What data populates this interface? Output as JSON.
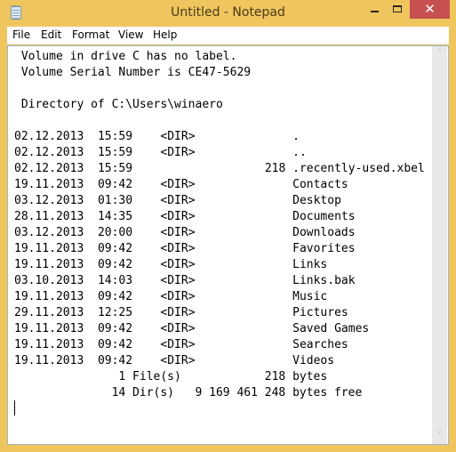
{
  "window": {
    "title": "Untitled - Notepad",
    "app_icon": "notepad-icon",
    "controls": {
      "minimize": "minimize-icon",
      "maximize": "maximize-icon",
      "close": "✕"
    },
    "accent_color": "#efc55e",
    "close_color": "#c75050"
  },
  "menu": {
    "items": [
      {
        "label": "File"
      },
      {
        "label": "Edit"
      },
      {
        "label": "Format"
      },
      {
        "label": "View"
      },
      {
        "label": "Help"
      }
    ]
  },
  "document": {
    "header_lines": [
      " Volume in drive C has no label.",
      " Volume Serial Number is CE47-5629",
      "",
      " Directory of C:\\Users\\winaero",
      ""
    ],
    "entries": [
      {
        "date": "02.12.2013",
        "time": "15:59",
        "type": "<DIR>",
        "size": "",
        "name": "."
      },
      {
        "date": "02.12.2013",
        "time": "15:59",
        "type": "<DIR>",
        "size": "",
        "name": ".."
      },
      {
        "date": "02.12.2013",
        "time": "15:59",
        "type": "",
        "size": "218",
        "name": ".recently-used.xbel"
      },
      {
        "date": "19.11.2013",
        "time": "09:42",
        "type": "<DIR>",
        "size": "",
        "name": "Contacts"
      },
      {
        "date": "03.12.2013",
        "time": "01:30",
        "type": "<DIR>",
        "size": "",
        "name": "Desktop"
      },
      {
        "date": "28.11.2013",
        "time": "14:35",
        "type": "<DIR>",
        "size": "",
        "name": "Documents"
      },
      {
        "date": "03.12.2013",
        "time": "20:00",
        "type": "<DIR>",
        "size": "",
        "name": "Downloads"
      },
      {
        "date": "19.11.2013",
        "time": "09:42",
        "type": "<DIR>",
        "size": "",
        "name": "Favorites"
      },
      {
        "date": "19.11.2013",
        "time": "09:42",
        "type": "<DIR>",
        "size": "",
        "name": "Links"
      },
      {
        "date": "03.10.2013",
        "time": "14:03",
        "type": "<DIR>",
        "size": "",
        "name": "Links.bak"
      },
      {
        "date": "19.11.2013",
        "time": "09:42",
        "type": "<DIR>",
        "size": "",
        "name": "Music"
      },
      {
        "date": "29.11.2013",
        "time": "12:25",
        "type": "<DIR>",
        "size": "",
        "name": "Pictures"
      },
      {
        "date": "19.11.2013",
        "time": "09:42",
        "type": "<DIR>",
        "size": "",
        "name": "Saved Games"
      },
      {
        "date": "19.11.2013",
        "time": "09:42",
        "type": "<DIR>",
        "size": "",
        "name": "Searches"
      },
      {
        "date": "19.11.2013",
        "time": "09:42",
        "type": "<DIR>",
        "size": "",
        "name": "Videos"
      }
    ],
    "summary": {
      "files_count": "1",
      "files_label": "File(s)",
      "files_bytes": "218 bytes",
      "dirs_count": "14",
      "dirs_label": "Dir(s)",
      "free_bytes": "9 169 461 248 bytes free"
    }
  },
  "scrollbar": {
    "up": "˄",
    "down": "˅"
  }
}
